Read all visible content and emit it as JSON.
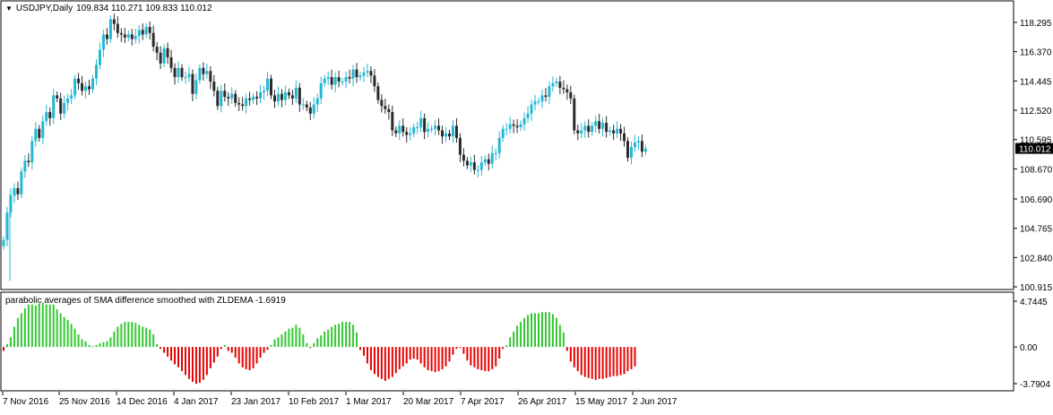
{
  "window": {
    "symbol": "USDJPY,Daily",
    "ohlc": "109.834 110.271 109.833 110.012",
    "menu_icon": "triangle-down-icon"
  },
  "colors": {
    "up": "#25b7d3",
    "down": "#2b2b2b",
    "positive": "#32c832",
    "negative": "#e60000",
    "frame": "#000000",
    "current_price_bg": "#000000",
    "current_price_fg": "#ffffff"
  },
  "price_axis": {
    "ticks": [
      "118.295",
      "116.370",
      "114.445",
      "112.520",
      "110.595",
      "108.670",
      "106.690",
      "104.765",
      "102.840",
      "100.915"
    ],
    "current": "110.012"
  },
  "indicator": {
    "title": "parabolic averages of SMA difference smoothed with ZLDEMA -1.6919",
    "ticks": [
      "4.7445",
      "0.00",
      "-3.7904"
    ]
  },
  "time_axis": {
    "labels": [
      "7 Nov 2016",
      "25 Nov 2016",
      "14 Dec 2016",
      "4 Jan 2017",
      "23 Jan 2017",
      "10 Feb 2017",
      "1 Mar 2017",
      "20 Mar 2017",
      "7 Apr 2017",
      "26 Apr 2017",
      "15 May 2017",
      "2 Jun 2017"
    ]
  },
  "chart_data": [
    {
      "type": "candlestick",
      "title": "USDJPY,Daily",
      "ylim": [
        100.915,
        118.295
      ],
      "closes": [
        104.0,
        105.8,
        106.9,
        107.4,
        107.0,
        108.5,
        109.2,
        109.1,
        110.5,
        111.3,
        110.7,
        111.8,
        112.4,
        112.0,
        113.5,
        113.3,
        112.3,
        113.0,
        113.3,
        113.5,
        114.6,
        114.3,
        113.8,
        114.1,
        113.9,
        114.6,
        115.5,
        116.5,
        117.5,
        117.2,
        118.5,
        118.2,
        117.6,
        117.5,
        117.3,
        117.5,
        117.2,
        117.4,
        117.8,
        117.5,
        118.0,
        117.6,
        116.7,
        116.3,
        115.6,
        116.6,
        116.0,
        115.3,
        114.7,
        115.3,
        114.7,
        114.7,
        114.9,
        113.6,
        114.5,
        115.3,
        114.9,
        115.1,
        114.4,
        113.8,
        112.8,
        113.8,
        113.4,
        113.3,
        113.6,
        113.0,
        112.9,
        112.8,
        113.3,
        113.2,
        113.4,
        113.3,
        113.7,
        113.8,
        114.6,
        113.5,
        113.1,
        113.6,
        113.2,
        113.7,
        113.5,
        113.3,
        114.0,
        112.9,
        112.9,
        112.7,
        112.3,
        112.9,
        113.3,
        114.3,
        114.6,
        114.7,
        114.2,
        114.7,
        114.4,
        114.4,
        114.7,
        114.6,
        115.2,
        114.7,
        114.8,
        115.0,
        115.1,
        114.8,
        114.1,
        113.2,
        112.8,
        112.6,
        112.4,
        111.2,
        111.0,
        111.5,
        111.1,
        110.9,
        111.0,
        111.4,
        111.4,
        112.0,
        111.1,
        111.3,
        111.3,
        111.5,
        111.2,
        110.8,
        111.0,
        110.8,
        111.5,
        110.7,
        109.6,
        109.2,
        108.9,
        109.1,
        108.6,
        108.6,
        109.1,
        109.3,
        109.0,
        109.7,
        109.7,
        110.7,
        111.3,
        111.3,
        111.6,
        111.5,
        111.4,
        111.6,
        112.0,
        112.3,
        112.9,
        113.1,
        113.1,
        113.5,
        113.4,
        114.1,
        114.3,
        114.4,
        114.0,
        113.9,
        113.7,
        113.3,
        111.2,
        111.0,
        111.2,
        111.5,
        111.1,
        111.5,
        111.8,
        111.3,
        111.7,
        111.1,
        111.2,
        111.0,
        111.3,
        111.0,
        110.5,
        109.4,
        110.1,
        110.4,
        110.5,
        109.8,
        110.0
      ]
    },
    {
      "type": "bar",
      "title": "parabolic averages of SMA difference smoothed with ZLDEMA -1.6919",
      "ylim": [
        -3.7904,
        4.7445
      ],
      "values": [
        -0.4,
        0.3,
        1.0,
        2.1,
        3.0,
        3.5,
        4.0,
        4.4,
        4.4,
        4.3,
        4.5,
        4.6,
        4.4,
        4.4,
        4.4,
        3.9,
        3.5,
        3.1,
        2.8,
        2.4,
        1.9,
        1.3,
        0.8,
        0.6,
        0.2,
        0.1,
        0.2,
        0.4,
        0.5,
        0.6,
        1.0,
        1.6,
        2.1,
        2.4,
        2.6,
        2.6,
        2.6,
        2.5,
        2.3,
        2.1,
        2.0,
        1.8,
        1.3,
        0.3,
        -0.2,
        -0.6,
        -1.0,
        -1.4,
        -1.8,
        -2.1,
        -2.5,
        -2.9,
        -3.3,
        -3.6,
        -3.8,
        -3.7,
        -3.4,
        -2.9,
        -2.2,
        -1.6,
        -1.0,
        -0.2,
        0.2,
        -0.4,
        -0.6,
        -1.1,
        -1.7,
        -2.1,
        -2.3,
        -2.4,
        -2.2,
        -1.7,
        -1.1,
        -0.6,
        -0.3,
        0.2,
        0.8,
        1.0,
        1.3,
        1.6,
        1.9,
        2.0,
        2.3,
        2.0,
        1.3,
        0.4,
        -0.1,
        0.4,
        0.9,
        1.2,
        1.6,
        1.8,
        2.1,
        2.3,
        2.4,
        2.6,
        2.6,
        2.6,
        2.3,
        1.5,
        -0.3,
        -0.9,
        -1.7,
        -2.4,
        -2.8,
        -3.1,
        -3.3,
        -3.5,
        -3.3,
        -3.1,
        -2.7,
        -2.3,
        -2.0,
        -1.7,
        -1.3,
        -1.2,
        -1.3,
        -1.7,
        -2.1,
        -2.4,
        -2.5,
        -2.6,
        -2.5,
        -2.3,
        -2.0,
        -1.5,
        -0.8,
        -0.2,
        -0.1,
        -0.7,
        -1.4,
        -1.9,
        -2.1,
        -2.3,
        -2.4,
        -2.5,
        -2.5,
        -2.3,
        -2.0,
        -1.2,
        -0.2,
        0.2,
        1.0,
        1.6,
        2.2,
        2.6,
        3.0,
        3.3,
        3.5,
        3.5,
        3.5,
        3.6,
        3.6,
        3.6,
        3.4,
        3.0,
        2.3,
        1.5,
        -0.4,
        -1.5,
        -2.1,
        -2.5,
        -2.9,
        -3.1,
        -3.2,
        -3.3,
        -3.4,
        -3.3,
        -3.3,
        -3.2,
        -3.1,
        -3.0,
        -3.0,
        -2.9,
        -2.8,
        -2.5,
        -2.3,
        -2.0
      ]
    }
  ]
}
